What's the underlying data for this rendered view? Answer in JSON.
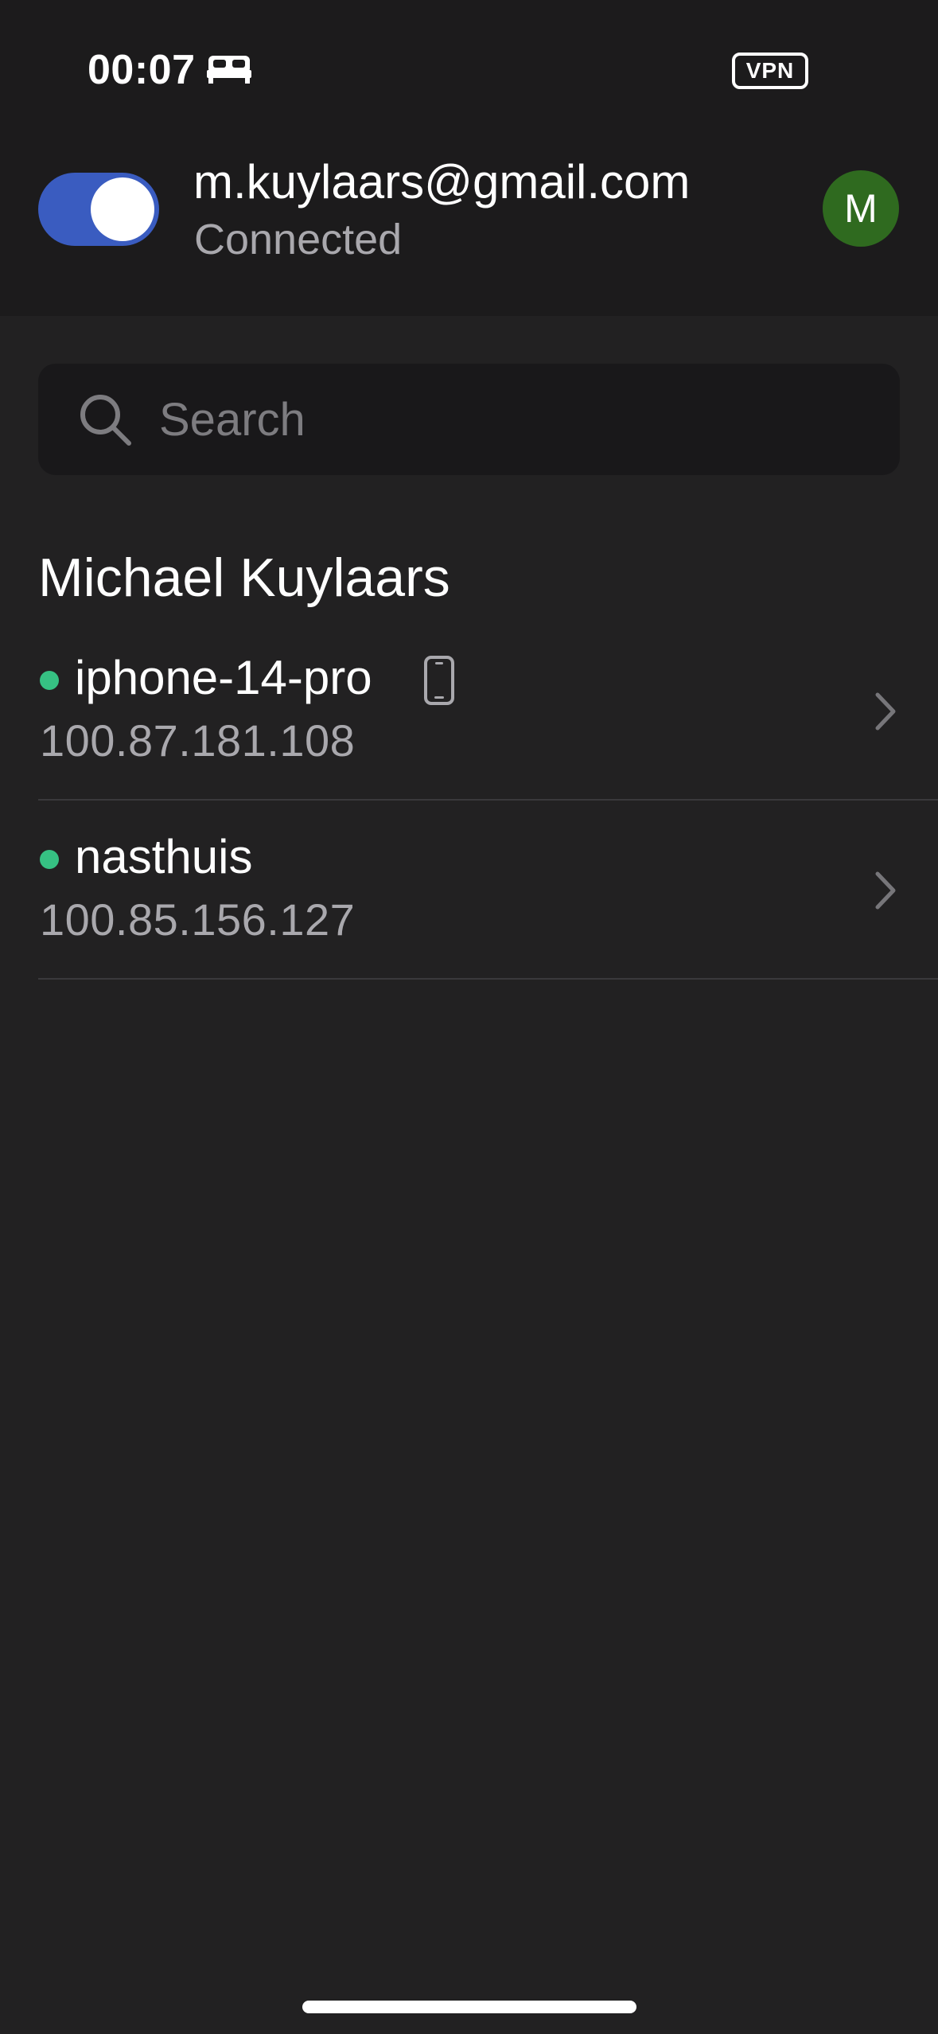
{
  "status_bar": {
    "time": "00:07",
    "sleep_icon": "bed-icon",
    "vpn_label": "VPN"
  },
  "account": {
    "email": "m.kuylaars@gmail.com",
    "status": "Connected",
    "avatar_initial": "M",
    "toggle_on": true,
    "colors": {
      "toggle": "#3a5cc0",
      "avatar": "#2f6a1f"
    }
  },
  "search": {
    "placeholder": "Search",
    "value": ""
  },
  "devices_section": {
    "title": "Michael Kuylaars",
    "items": [
      {
        "name": "iphone-14-pro",
        "ip": "100.87.181.108",
        "online": true,
        "is_this_device": true,
        "icon": "phone-icon"
      },
      {
        "name": "nasthuis",
        "ip": "100.85.156.127",
        "online": true,
        "is_this_device": false
      }
    ],
    "online_color": "#36c183"
  }
}
